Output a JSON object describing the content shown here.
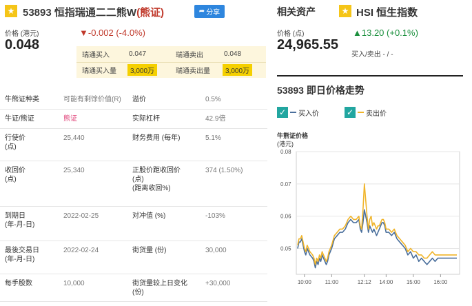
{
  "header": {
    "code": "53893",
    "name": "恒指瑞通二二熊W",
    "type_tag": "(熊证)",
    "share_label": "分享"
  },
  "warrant": {
    "price_label": "价格 (港元)",
    "price": "0.048",
    "change": "-0.002 (-4.0%)",
    "bid_label": "瑞通买入",
    "bid": "0.047",
    "ask_label": "瑞通卖出",
    "ask": "0.048",
    "bid_qty_label": "瑞通买入量",
    "bid_qty": "3,000万",
    "ask_qty_label": "瑞通卖出量",
    "ask_qty": "3,000万"
  },
  "details": [
    {
      "l1": "牛熊证种类",
      "v1": "可能有剩馀价值(R)",
      "l2": "溢价",
      "v2": "0.5%"
    },
    {
      "l1": "牛证/熊证",
      "v1": "熊证",
      "l2": "实际杠杆",
      "v2": "42.9倍"
    },
    {
      "l1": "行使价\n(点)",
      "v1": "25,440",
      "l2": "财务费用 (每年)",
      "v2": "5.1%"
    },
    {
      "l1": "收回价\n(点)",
      "v1": "25,340",
      "l2": "正股价距收回价\n(点)\n(距离收回%)",
      "v2": "374 (1.50%)"
    },
    {
      "l1": "到期日\n(年-月-日)",
      "v1": "2022-02-25",
      "l2": "对冲值 (%)",
      "v2": "-103%"
    },
    {
      "l1": "最後交易日\n(年-月-日)",
      "v1": "2022-02-24",
      "l2": "街货量 (份)",
      "v2": "30,000"
    },
    {
      "l1": "每手股数",
      "v1": "10,000",
      "l2": "街货量较上日变化\n(份)",
      "v2": "+30,000"
    }
  ],
  "related": {
    "title": "相关资产",
    "asset_name": "HSI 恒生指数",
    "price_label": "价格 (点)",
    "price": "24,965.55",
    "change": "13.20 (+0.1%)",
    "bid_ask": "买入/卖出 - / -"
  },
  "chart_section": {
    "title": "53893 即日价格走势",
    "legend_bid": "买入价",
    "legend_ask": "卖出价",
    "check": "✓",
    "ylabel_line1": "牛熊证价格",
    "ylabel_line2": "(港元)"
  },
  "colors": {
    "bid": "#4a6f9c",
    "ask": "#f0b429",
    "accent": "#22a6a0",
    "down": "#c0392b",
    "up": "#1a8f3c"
  },
  "chart_data": {
    "type": "line",
    "xlabel": "",
    "ylabel": "牛熊证价格 (港元)",
    "ylim": [
      0.042,
      0.08
    ],
    "yticks": [
      "0.08",
      "0.07",
      "0.06",
      "0.05"
    ],
    "yticks_values": [
      0.08,
      0.07,
      0.06,
      0.05
    ],
    "xticks": [
      "10:00",
      "11:00",
      "12:12",
      "14:00",
      "15:00",
      "16:00"
    ],
    "xticks_values": [
      0,
      1,
      2.2,
      3,
      4,
      5
    ],
    "x": [
      -0.25,
      -0.2,
      -0.15,
      -0.1,
      -0.05,
      0,
      0.05,
      0.1,
      0.2,
      0.3,
      0.35,
      0.4,
      0.45,
      0.5,
      0.55,
      0.6,
      0.65,
      0.7,
      0.75,
      0.8,
      0.85,
      0.9,
      1,
      1.1,
      1.2,
      1.3,
      1.4,
      1.5,
      1.6,
      1.7,
      1.8,
      1.9,
      2,
      2.05,
      2.1,
      2.15,
      2.2,
      2.3,
      2.35,
      2.4,
      2.45,
      2.5,
      2.55,
      2.6,
      2.65,
      2.7,
      2.75,
      2.8,
      2.85,
      2.9,
      2.95,
      3,
      3.1,
      3.2,
      3.3,
      3.4,
      3.5,
      3.6,
      3.7,
      3.8,
      3.9,
      4,
      4.1,
      4.2,
      4.3,
      4.4,
      4.5,
      4.6,
      4.7,
      4.8,
      4.9,
      5,
      5.2,
      5.4,
      5.6
    ],
    "series": [
      {
        "name": "买入价",
        "values": [
          0.05,
          0.052,
          0.052,
          0.053,
          0.051,
          0.049,
          0.048,
          0.05,
          0.048,
          0.047,
          0.046,
          0.044,
          0.046,
          0.045,
          0.047,
          0.046,
          0.048,
          0.047,
          0.046,
          0.045,
          0.046,
          0.048,
          0.05,
          0.053,
          0.054,
          0.055,
          0.055,
          0.056,
          0.058,
          0.059,
          0.058,
          0.058,
          0.059,
          0.056,
          0.055,
          0.058,
          0.062,
          0.058,
          0.055,
          0.057,
          0.056,
          0.055,
          0.056,
          0.055,
          0.054,
          0.055,
          0.056,
          0.057,
          0.058,
          0.058,
          0.057,
          0.055,
          0.055,
          0.054,
          0.055,
          0.053,
          0.052,
          0.051,
          0.05,
          0.048,
          0.049,
          0.047,
          0.048,
          0.046,
          0.047,
          0.046,
          0.045,
          0.046,
          0.047,
          0.046,
          0.047,
          0.047,
          0.047,
          0.047,
          0.047
        ]
      },
      {
        "name": "卖出价",
        "values": [
          0.051,
          0.053,
          0.053,
          0.054,
          0.052,
          0.05,
          0.049,
          0.051,
          0.049,
          0.048,
          0.047,
          0.045,
          0.047,
          0.046,
          0.048,
          0.047,
          0.049,
          0.048,
          0.047,
          0.046,
          0.047,
          0.049,
          0.051,
          0.054,
          0.055,
          0.056,
          0.056,
          0.057,
          0.059,
          0.06,
          0.059,
          0.059,
          0.06,
          0.057,
          0.056,
          0.062,
          0.07,
          0.06,
          0.056,
          0.059,
          0.06,
          0.057,
          0.058,
          0.057,
          0.056,
          0.057,
          0.057,
          0.058,
          0.059,
          0.059,
          0.058,
          0.056,
          0.056,
          0.055,
          0.056,
          0.054,
          0.053,
          0.052,
          0.051,
          0.049,
          0.05,
          0.049,
          0.049,
          0.048,
          0.048,
          0.047,
          0.047,
          0.048,
          0.049,
          0.048,
          0.048,
          0.048,
          0.048,
          0.048,
          0.048
        ]
      }
    ]
  }
}
